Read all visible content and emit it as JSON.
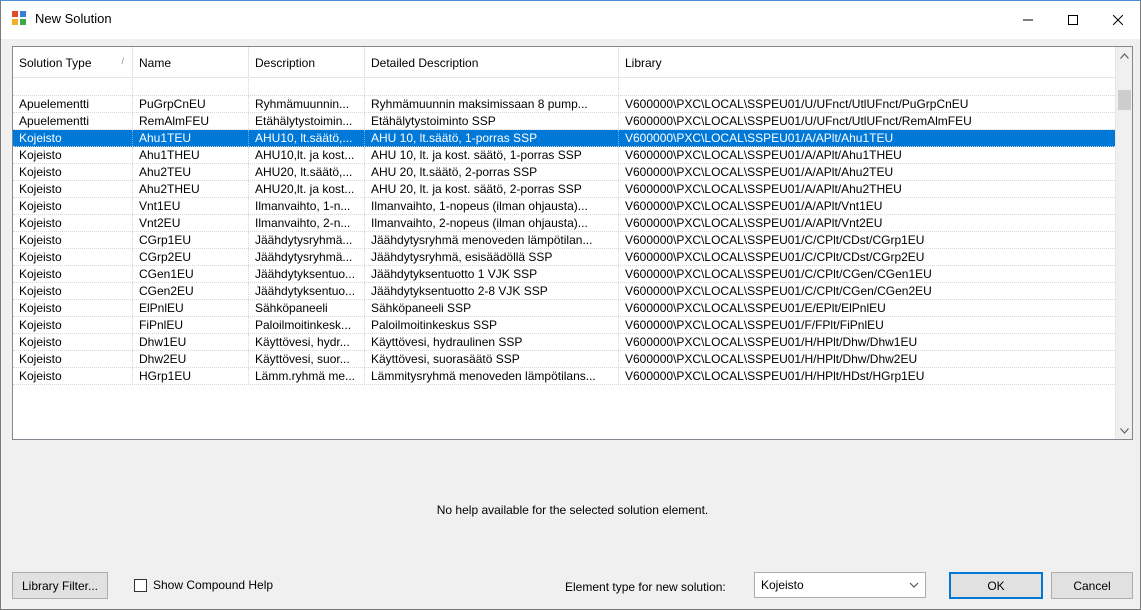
{
  "window": {
    "title": "New Solution"
  },
  "grid": {
    "columns": [
      "Solution Type",
      "Name",
      "Description",
      "Detailed Description",
      "Library"
    ],
    "rows": [
      [
        "Apuelementti",
        "PuGrpCnEU",
        "Ryhmämuunnin...",
        "Ryhmämuunnin maksimissaan 8 pump...",
        "V600000\\PXC\\LOCAL\\SSPEU01/U/UFnct/UtlUFnct/PuGrpCnEU"
      ],
      [
        "Apuelementti",
        "RemAlmFEU",
        "Etähälytystoimin...",
        "Etähälytystoiminto SSP",
        "V600000\\PXC\\LOCAL\\SSPEU01/U/UFnct/UtlUFnct/RemAlmFEU"
      ],
      [
        "Kojeisto",
        "Ahu1TEU",
        "AHU10, lt.säätö,...",
        "AHU 10, lt.säätö, 1-porras SSP",
        "V600000\\PXC\\LOCAL\\SSPEU01/A/APlt/Ahu1TEU"
      ],
      [
        "Kojeisto",
        "Ahu1THEU",
        "AHU10,lt. ja kost...",
        "AHU 10, lt. ja kost. säätö, 1-porras SSP",
        "V600000\\PXC\\LOCAL\\SSPEU01/A/APlt/Ahu1THEU"
      ],
      [
        "Kojeisto",
        "Ahu2TEU",
        "AHU20, lt.säätö,...",
        "AHU 20, lt.säätö, 2-porras SSP",
        "V600000\\PXC\\LOCAL\\SSPEU01/A/APlt/Ahu2TEU"
      ],
      [
        "Kojeisto",
        "Ahu2THEU",
        "AHU20,lt. ja kost...",
        "AHU 20, lt. ja kost. säätö, 2-porras SSP",
        "V600000\\PXC\\LOCAL\\SSPEU01/A/APlt/Ahu2THEU"
      ],
      [
        "Kojeisto",
        "Vnt1EU",
        "Ilmanvaihto, 1-n...",
        "Ilmanvaihto, 1-nopeus (ilman ohjausta)...",
        "V600000\\PXC\\LOCAL\\SSPEU01/A/APlt/Vnt1EU"
      ],
      [
        "Kojeisto",
        "Vnt2EU",
        "Ilmanvaihto, 2-n...",
        "Ilmanvaihto, 2-nopeus (ilman ohjausta)...",
        "V600000\\PXC\\LOCAL\\SSPEU01/A/APlt/Vnt2EU"
      ],
      [
        "Kojeisto",
        "CGrp1EU",
        "Jäähdytysryhmä...",
        "Jäähdytysryhmä menoveden lämpötilan...",
        "V600000\\PXC\\LOCAL\\SSPEU01/C/CPlt/CDst/CGrp1EU"
      ],
      [
        "Kojeisto",
        "CGrp2EU",
        "Jäähdytysryhmä...",
        "Jäähdytysryhmä, esisäädöllä SSP",
        "V600000\\PXC\\LOCAL\\SSPEU01/C/CPlt/CDst/CGrp2EU"
      ],
      [
        "Kojeisto",
        "CGen1EU",
        "Jäähdytyksentuo...",
        "Jäähdytyksentuotto 1 VJK SSP",
        "V600000\\PXC\\LOCAL\\SSPEU01/C/CPlt/CGen/CGen1EU"
      ],
      [
        "Kojeisto",
        "CGen2EU",
        "Jäähdytyksentuo...",
        "Jäähdytyksentuotto 2-8 VJK SSP",
        "V600000\\PXC\\LOCAL\\SSPEU01/C/CPlt/CGen/CGen2EU"
      ],
      [
        "Kojeisto",
        "ElPnlEU",
        "Sähköpaneeli",
        "Sähköpaneeli SSP",
        "V600000\\PXC\\LOCAL\\SSPEU01/E/EPlt/ElPnlEU"
      ],
      [
        "Kojeisto",
        "FiPnlEU",
        "Paloilmoitinkesk...",
        "Paloilmoitinkeskus SSP",
        "V600000\\PXC\\LOCAL\\SSPEU01/F/FPlt/FiPnlEU"
      ],
      [
        "Kojeisto",
        "Dhw1EU",
        "Käyttövesi, hydr...",
        "Käyttövesi, hydraulinen SSP",
        "V600000\\PXC\\LOCAL\\SSPEU01/H/HPlt/Dhw/Dhw1EU"
      ],
      [
        "Kojeisto",
        "Dhw2EU",
        "Käyttövesi, suor...",
        "Käyttövesi, suorasäätö SSP",
        "V600000\\PXC\\LOCAL\\SSPEU01/H/HPlt/Dhw/Dhw2EU"
      ],
      [
        "Kojeisto",
        "HGrp1EU",
        "Lämm.ryhmä me...",
        "Lämmitysryhmä menoveden lämpötilans...",
        "V600000\\PXC\\LOCAL\\SSPEU01/H/HPlt/HDst/HGrp1EU"
      ]
    ],
    "selected_index": 2
  },
  "help": {
    "message": "No help available for the selected solution element."
  },
  "footer": {
    "library_filter_label": "Library Filter...",
    "show_compound_help_label": "Show Compound Help",
    "element_type_label": "Element type for new solution:",
    "element_type_value": "Kojeisto",
    "ok_label": "OK",
    "cancel_label": "Cancel"
  },
  "colors": {
    "selection": "#0078d7",
    "window_bg": "#f0f0f0"
  }
}
